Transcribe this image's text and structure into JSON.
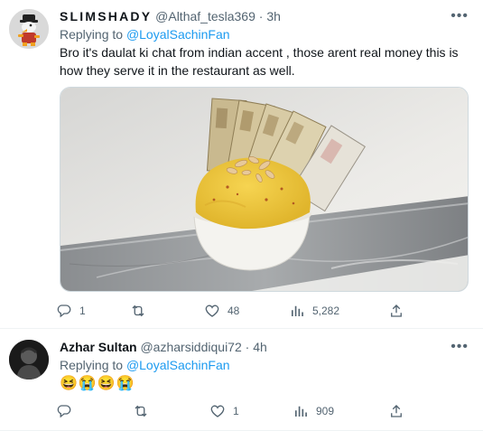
{
  "tweets": [
    {
      "author_name": "SLIMSHADY",
      "handle": "@Althaf_tesla369",
      "separator": "·",
      "time": "3h",
      "replying_label": "Replying to",
      "replying_to": "@LoyalSachinFan",
      "text": "Bro it's daulat ki chat from indian accent , those arent real money this is how they serve it in the restaurant as well.",
      "media_description_icon": "dessert-photo",
      "actions": {
        "replies": "1",
        "retweets": "",
        "likes": "48",
        "views": "5,282"
      }
    },
    {
      "author_name": "Azhar Sultan",
      "handle": "@azharsiddiqui72",
      "separator": "·",
      "time": "4h",
      "replying_label": "Replying to",
      "replying_to": "@LoyalSachinFan",
      "text": "😆😭😆😭",
      "actions": {
        "replies": "",
        "retweets": "",
        "likes": "1",
        "views": "909"
      }
    }
  ],
  "icons": {
    "more": "more-horizontal-icon",
    "reply": "reply-icon",
    "retweet": "retweet-icon",
    "like": "heart-icon",
    "views": "views-icon",
    "share": "share-icon"
  },
  "colors": {
    "link": "#1d9bf0",
    "secondary_text": "#536471",
    "primary_text": "#0f1419",
    "divider": "#eff3f4"
  }
}
